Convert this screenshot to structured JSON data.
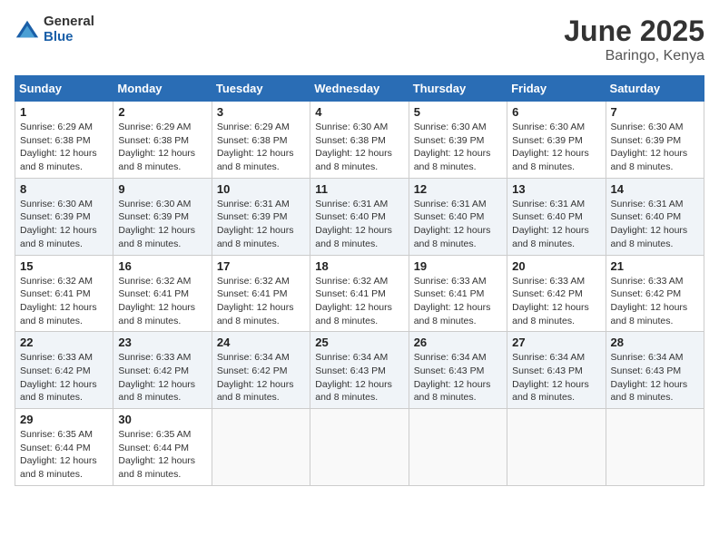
{
  "header": {
    "logo_general": "General",
    "logo_blue": "Blue",
    "month_title": "June 2025",
    "location": "Baringo, Kenya"
  },
  "days_of_week": [
    "Sunday",
    "Monday",
    "Tuesday",
    "Wednesday",
    "Thursday",
    "Friday",
    "Saturday"
  ],
  "weeks": [
    [
      {
        "day": "1",
        "sunrise": "6:29 AM",
        "sunset": "6:38 PM",
        "daylight": "12 hours and 8 minutes."
      },
      {
        "day": "2",
        "sunrise": "6:29 AM",
        "sunset": "6:38 PM",
        "daylight": "12 hours and 8 minutes."
      },
      {
        "day": "3",
        "sunrise": "6:29 AM",
        "sunset": "6:38 PM",
        "daylight": "12 hours and 8 minutes."
      },
      {
        "day": "4",
        "sunrise": "6:30 AM",
        "sunset": "6:38 PM",
        "daylight": "12 hours and 8 minutes."
      },
      {
        "day": "5",
        "sunrise": "6:30 AM",
        "sunset": "6:39 PM",
        "daylight": "12 hours and 8 minutes."
      },
      {
        "day": "6",
        "sunrise": "6:30 AM",
        "sunset": "6:39 PM",
        "daylight": "12 hours and 8 minutes."
      },
      {
        "day": "7",
        "sunrise": "6:30 AM",
        "sunset": "6:39 PM",
        "daylight": "12 hours and 8 minutes."
      }
    ],
    [
      {
        "day": "8",
        "sunrise": "6:30 AM",
        "sunset": "6:39 PM",
        "daylight": "12 hours and 8 minutes."
      },
      {
        "day": "9",
        "sunrise": "6:30 AM",
        "sunset": "6:39 PM",
        "daylight": "12 hours and 8 minutes."
      },
      {
        "day": "10",
        "sunrise": "6:31 AM",
        "sunset": "6:39 PM",
        "daylight": "12 hours and 8 minutes."
      },
      {
        "day": "11",
        "sunrise": "6:31 AM",
        "sunset": "6:40 PM",
        "daylight": "12 hours and 8 minutes."
      },
      {
        "day": "12",
        "sunrise": "6:31 AM",
        "sunset": "6:40 PM",
        "daylight": "12 hours and 8 minutes."
      },
      {
        "day": "13",
        "sunrise": "6:31 AM",
        "sunset": "6:40 PM",
        "daylight": "12 hours and 8 minutes."
      },
      {
        "day": "14",
        "sunrise": "6:31 AM",
        "sunset": "6:40 PM",
        "daylight": "12 hours and 8 minutes."
      }
    ],
    [
      {
        "day": "15",
        "sunrise": "6:32 AM",
        "sunset": "6:41 PM",
        "daylight": "12 hours and 8 minutes."
      },
      {
        "day": "16",
        "sunrise": "6:32 AM",
        "sunset": "6:41 PM",
        "daylight": "12 hours and 8 minutes."
      },
      {
        "day": "17",
        "sunrise": "6:32 AM",
        "sunset": "6:41 PM",
        "daylight": "12 hours and 8 minutes."
      },
      {
        "day": "18",
        "sunrise": "6:32 AM",
        "sunset": "6:41 PM",
        "daylight": "12 hours and 8 minutes."
      },
      {
        "day": "19",
        "sunrise": "6:33 AM",
        "sunset": "6:41 PM",
        "daylight": "12 hours and 8 minutes."
      },
      {
        "day": "20",
        "sunrise": "6:33 AM",
        "sunset": "6:42 PM",
        "daylight": "12 hours and 8 minutes."
      },
      {
        "day": "21",
        "sunrise": "6:33 AM",
        "sunset": "6:42 PM",
        "daylight": "12 hours and 8 minutes."
      }
    ],
    [
      {
        "day": "22",
        "sunrise": "6:33 AM",
        "sunset": "6:42 PM",
        "daylight": "12 hours and 8 minutes."
      },
      {
        "day": "23",
        "sunrise": "6:33 AM",
        "sunset": "6:42 PM",
        "daylight": "12 hours and 8 minutes."
      },
      {
        "day": "24",
        "sunrise": "6:34 AM",
        "sunset": "6:42 PM",
        "daylight": "12 hours and 8 minutes."
      },
      {
        "day": "25",
        "sunrise": "6:34 AM",
        "sunset": "6:43 PM",
        "daylight": "12 hours and 8 minutes."
      },
      {
        "day": "26",
        "sunrise": "6:34 AM",
        "sunset": "6:43 PM",
        "daylight": "12 hours and 8 minutes."
      },
      {
        "day": "27",
        "sunrise": "6:34 AM",
        "sunset": "6:43 PM",
        "daylight": "12 hours and 8 minutes."
      },
      {
        "day": "28",
        "sunrise": "6:34 AM",
        "sunset": "6:43 PM",
        "daylight": "12 hours and 8 minutes."
      }
    ],
    [
      {
        "day": "29",
        "sunrise": "6:35 AM",
        "sunset": "6:44 PM",
        "daylight": "12 hours and 8 minutes."
      },
      {
        "day": "30",
        "sunrise": "6:35 AM",
        "sunset": "6:44 PM",
        "daylight": "12 hours and 8 minutes."
      },
      null,
      null,
      null,
      null,
      null
    ]
  ],
  "labels": {
    "sunrise": "Sunrise:",
    "sunset": "Sunset:",
    "daylight": "Daylight:"
  }
}
